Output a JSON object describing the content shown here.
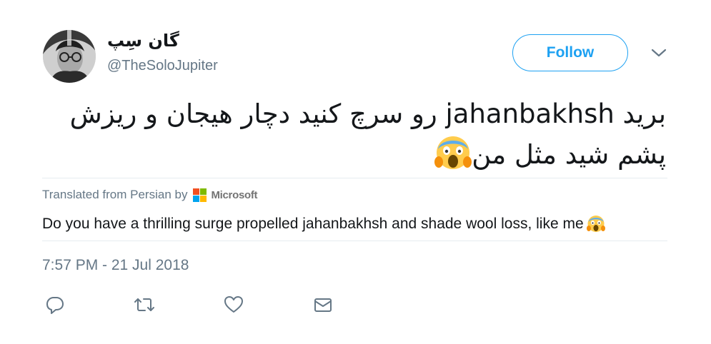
{
  "user": {
    "name": "گان سِپ",
    "handle": "@TheSoloJupiter",
    "avatar_icon": "profile-photo"
  },
  "follow_label": "Follow",
  "tweet": {
    "text": "برید jahanbakhsh رو سرچ کنید دچار هیجان و ریزش پشم شید مثل من",
    "emoji": "face-screaming-in-fear"
  },
  "translation": {
    "label": "Translated from Persian by",
    "provider": "Microsoft",
    "text": "Do you have a thrilling surge propelled jahanbakhsh and shade wool loss, like me",
    "emoji": "face-screaming-in-fear"
  },
  "timestamp": "7:57 PM - 21 Jul 2018",
  "actions": [
    "reply-icon",
    "retweet-icon",
    "like-icon",
    "message-icon"
  ],
  "colors": {
    "accent": "#1da1f2",
    "secondary_text": "#657786",
    "divider": "#e6ecf0"
  }
}
